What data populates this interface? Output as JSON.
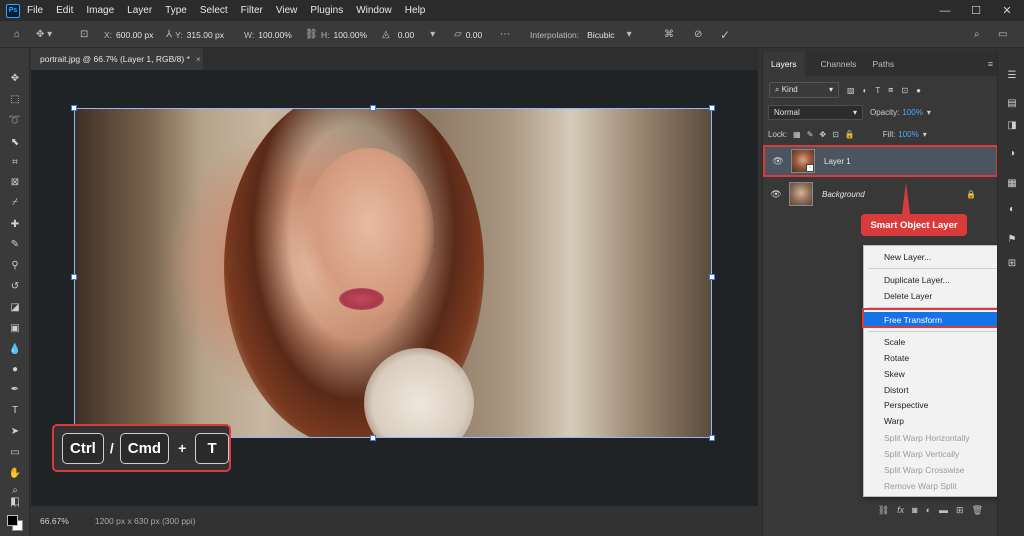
{
  "app": {
    "logo": "Ps"
  },
  "menu": [
    "File",
    "Edit",
    "Image",
    "Layer",
    "Type",
    "Select",
    "Filter",
    "View",
    "Plugins",
    "Window",
    "Help"
  ],
  "window_controls": {
    "minimize": "—",
    "maximize": "☐",
    "close": "✕"
  },
  "options": {
    "x_label": "X:",
    "x_value": "600.00 px",
    "y_label": "Y:",
    "y_value": "315.00 px",
    "w_label": "W:",
    "w_value": "100.00%",
    "h_label": "H:",
    "h_value": "100.00%",
    "angle_value": "0.00",
    "skew_value": "0.00",
    "interp_label": "Interpolation:",
    "interp_value": "Bicubic"
  },
  "document": {
    "tab_title": "portrait.jpg @ 66.7% (Layer 1, RGB/8) *",
    "close": "×"
  },
  "shortcut": {
    "key1": "Ctrl",
    "sep1": "/",
    "key2": "Cmd",
    "plus": "+",
    "key3": "T"
  },
  "status": {
    "zoom": "66.67%",
    "info": "1200 px x 630 px (300 ppi)"
  },
  "panel": {
    "tabs": [
      "Layers",
      "Channels",
      "Paths"
    ],
    "kind_label": "Kind",
    "blend_mode": "Normal",
    "opacity_label": "Opacity:",
    "opacity_value": "100%",
    "lock_label": "Lock:",
    "fill_label": "Fill:",
    "fill_value": "100%",
    "layers": [
      {
        "name": "Layer 1"
      },
      {
        "name": "Background"
      }
    ]
  },
  "callout": {
    "text": "Smart Object Layer"
  },
  "context_menu": {
    "new_layer": "New Layer...",
    "duplicate_layer": "Duplicate Layer...",
    "delete_layer": "Delete Layer",
    "free_transform": "Free Transform",
    "scale": "Scale",
    "rotate": "Rotate",
    "skew": "Skew",
    "distort": "Distort",
    "perspective": "Perspective",
    "warp": "Warp",
    "split_warp_h": "Split Warp Horizontally",
    "split_warp_v": "Split Warp Vertically",
    "split_warp_c": "Split Warp Crosswise",
    "remove_warp_split": "Remove Warp Split"
  },
  "colors": {
    "accent": "#1473e6",
    "highlight_red": "#d93b3b",
    "opacity_blue": "#4ea7ff"
  }
}
